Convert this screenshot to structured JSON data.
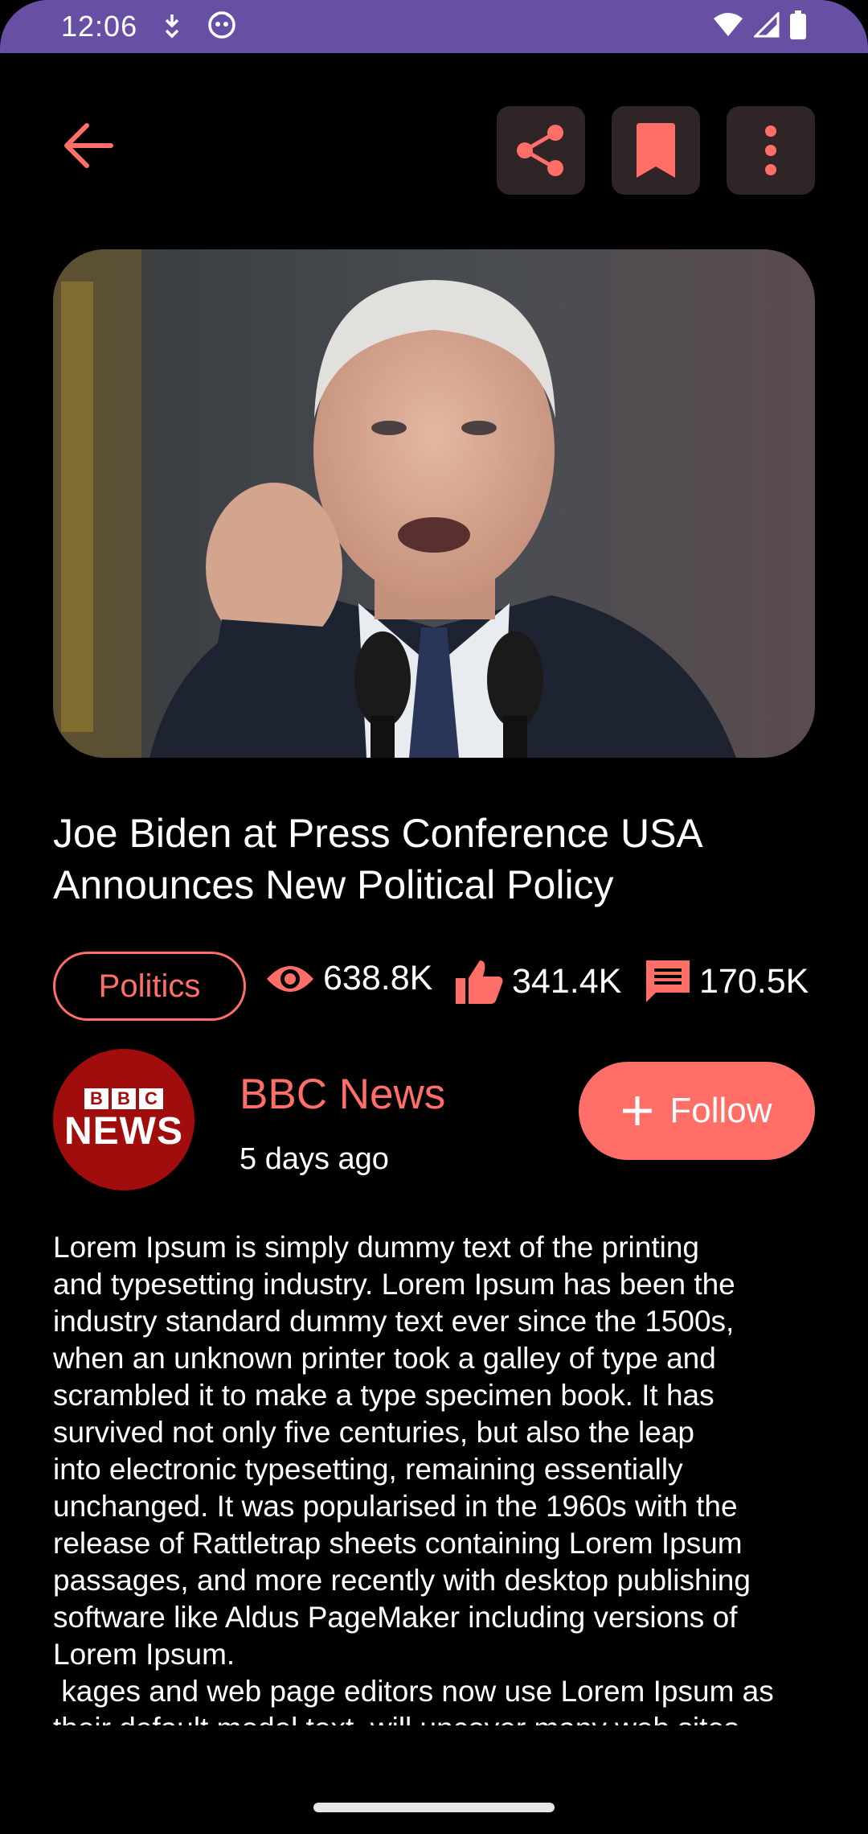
{
  "status_bar": {
    "time": "12:06"
  },
  "toolbar": {
    "back_icon": "arrow-back-icon",
    "actions": [
      "share-icon",
      "bookmark-icon",
      "more-vert-icon"
    ]
  },
  "article": {
    "image": "photo of speaker at press conference podium with microphones",
    "title": "Joe Biden at Press Conference USA Announces New Political Policy",
    "category": "Politics",
    "views": "638.8K",
    "likes": "341.4K",
    "comments": "170.5K",
    "body": "Lorem Ipsum is simply dummy text of the printing\nand typesetting industry. Lorem Ipsum has been the\nindustry standard dummy text ever since the 1500s,\nwhen an unknown printer took a galley of type and\nscrambled it to make a type specimen book. It has\nsurvived not only five centuries, but also the leap\ninto electronic typesetting, remaining essentially\nunchanged. It was popularised in the 1960s with the\nrelease of Rattletrap sheets containing Lorem Ipsum\npassages, and more recently with desktop publishing\nsoftware like Aldus PageMaker including versions of\nLorem Ipsum.\n kages and web page editors now use Lorem Ipsum as\ntheir default model text, will uncover many web sites"
  },
  "source": {
    "logo_top": [
      "B",
      "B",
      "C"
    ],
    "logo_bottom": "NEWS",
    "name": "BBC News",
    "time_ago": "5 days ago",
    "follow_label": "Follow"
  },
  "colors": {
    "accent": "#ff6e67",
    "status_bar": "#6750a4",
    "button_bg": "#2f2527",
    "background": "#000000",
    "logo_red": "#a10d0d"
  }
}
